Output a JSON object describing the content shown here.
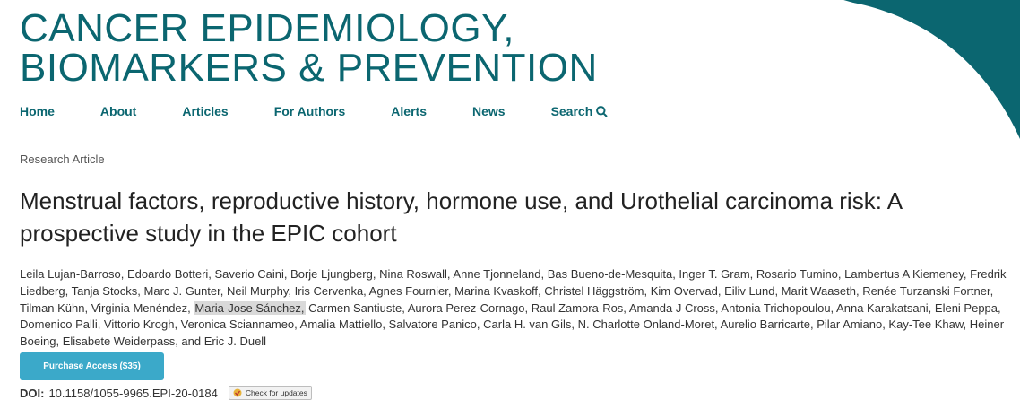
{
  "header": {
    "logo_line1": "CANCER EPIDEMIOLOGY,",
    "logo_line2": "BIOMARKERS & PREVENTION"
  },
  "nav": {
    "items": [
      "Home",
      "About",
      "Articles",
      "For Authors",
      "Alerts",
      "News",
      "Search"
    ]
  },
  "article": {
    "type": "Research Article",
    "title": "Menstrual factors, reproductive history, hormone use, and Urothelial carcinoma risk: A prospective study in the EPIC cohort",
    "authors_before": "Leila Lujan-Barroso, Edoardo Botteri, Saverio Caini, Borje Ljungberg, Nina Roswall, Anne Tjonneland, Bas Bueno-de-Mesquita, Inger T. Gram, Rosario Tumino, Lambertus A Kiemeney, Fredrik Liedberg, Tanja Stocks, Marc J. Gunter, Neil Murphy, Iris Cervenka, Agnes Fournier, Marina Kvaskoff, Christel Häggström, Kim Overvad, Eiliv Lund, Marit Waaseth, Renée Turzanski Fortner, Tilman Kühn, Virginia Menéndez,",
    "author_highlighted": "Maria-Jose Sánchez,",
    "authors_after": "Carmen Santiuste, Aurora Perez-Cornago, Raul Zamora-Ros, Amanda J Cross, Antonia Trichopoulou, Anna Karakatsani, Eleni Peppa, Domenico Palli, Vittorio Krogh, Veronica Sciannameo, Amalia Mattiello, Salvatore Panico, Carla H. van Gils, N. Charlotte Onland-Moret, Aurelio Barricarte, Pilar Amiano, Kay-Tee Khaw, Heiner Boeing, Elisabete Weiderpass, and Eric J. Duell",
    "purchase_label": "Purchase Access ($35)",
    "doi_label": "DOI:",
    "doi_value": "10.1158/1055-9965.EPI-20-0184",
    "check_updates_label": "Check for updates"
  },
  "colors": {
    "brand_teal": "#0b6670",
    "button_blue": "#3ba9c9",
    "highlight_gray": "#d9d9d9"
  },
  "icons": [
    "search-icon",
    "check-for-updates-icon",
    "header-swoosh-graphic"
  ]
}
